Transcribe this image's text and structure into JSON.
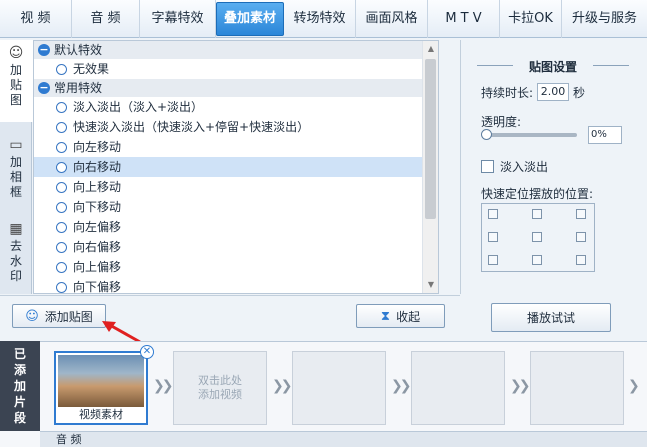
{
  "top_tabs": [
    "视 频",
    "音 频",
    "字幕特效",
    "叠加素材",
    "转场特效",
    "画面风格",
    "M T V",
    "卡拉OK",
    "升级与服务"
  ],
  "side_tabs": [
    {
      "label": "加贴图",
      "icon": "add-sticker-icon"
    },
    {
      "label": "加相框",
      "icon": "frame-icon"
    },
    {
      "label": "去水印",
      "icon": "watermark-icon"
    }
  ],
  "effect_groups": [
    {
      "name": "默认特效",
      "items": [
        "无效果"
      ]
    },
    {
      "name": "常用特效",
      "items": [
        "淡入淡出（淡入+淡出）",
        "快速淡入淡出（快速淡入+停留+快速淡出）",
        "向左移动",
        "向右移动",
        "向上移动",
        "向下移动",
        "向左偏移",
        "向右偏移",
        "向上偏移",
        "向下偏移"
      ]
    }
  ],
  "selected_item": "向右移动",
  "settings": {
    "title": "贴图设置",
    "duration_label": "持续时长:",
    "duration_value": "2.00",
    "duration_unit": "秒",
    "opacity_label": "透明度:",
    "opacity_value": "0%",
    "fade_label": "淡入淡出",
    "position_label": "快速定位摆放的位置:"
  },
  "buttons": {
    "add_sticker": "添加贴图",
    "collapse": "收起",
    "preview": "播放试试"
  },
  "timeline": {
    "side_label": [
      "已",
      "添",
      "加",
      "片",
      "段"
    ],
    "clip_caption": "视频素材",
    "empty_hint": [
      "双击此处",
      "添加视频"
    ],
    "audio_label": "音 频"
  },
  "colors": {
    "accent": "#2f7bd1",
    "selected_row": "#cfe2f7",
    "annotation_arrow": "#e02020"
  }
}
